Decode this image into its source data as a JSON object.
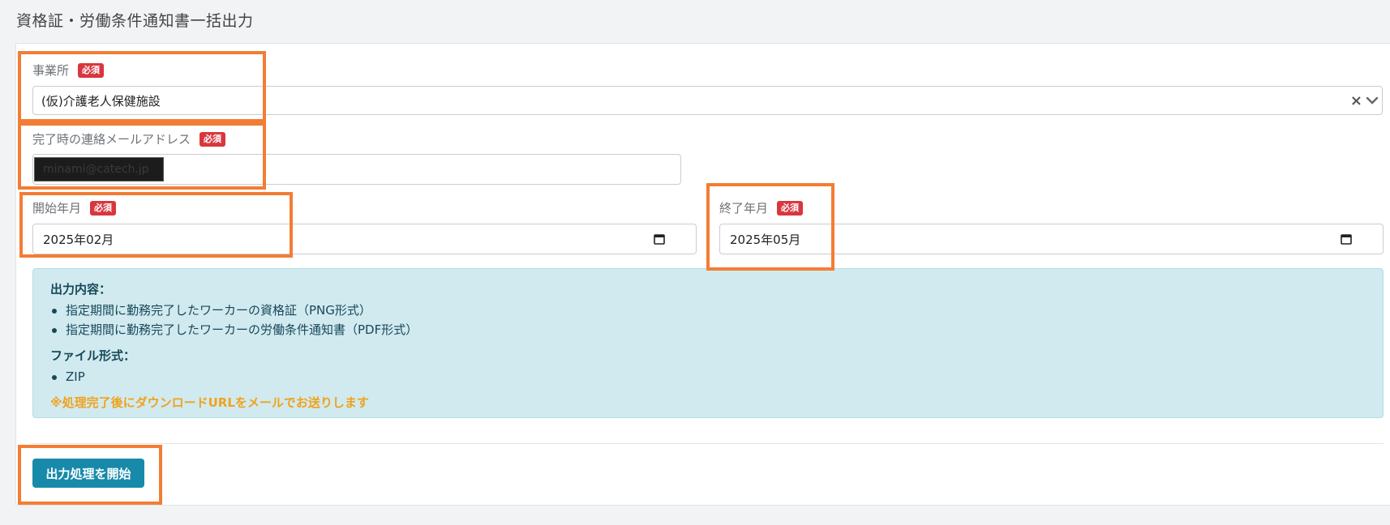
{
  "page": {
    "title": "資格証・労働条件通知書一括出力"
  },
  "form": {
    "office": {
      "label": "事業所",
      "badge": "必須",
      "value": "(仮)介護老人保健施設"
    },
    "email": {
      "label": "完了時の連絡メールアドレス",
      "badge": "必須",
      "value": "minami@catech.jp"
    },
    "start": {
      "label": "開始年月",
      "badge": "必須",
      "value": "2025年02月"
    },
    "end": {
      "label": "終了年月",
      "badge": "必須",
      "value": "2025年05月"
    }
  },
  "info": {
    "heading1": "出力内容：",
    "items1": [
      "指定期間に勤務完了したワーカーの資格証（PNG形式）",
      "指定期間に勤務完了したワーカーの労働条件通知書（PDF形式）"
    ],
    "heading2": "ファイル形式：",
    "items2": [
      "ZIP"
    ],
    "note": "※処理完了後にダウンロードURLをメールでお送りします"
  },
  "actions": {
    "start_label": "出力処理を開始"
  },
  "icons": {
    "clear": "close-icon",
    "dropdown": "chevron-down-icon",
    "calendar": "calendar-icon"
  },
  "colors": {
    "accent": "#178aaa",
    "badge": "#d9363e",
    "highlight": "#f37d34",
    "info_bg": "#d1eaef",
    "note": "#f0a21c"
  }
}
